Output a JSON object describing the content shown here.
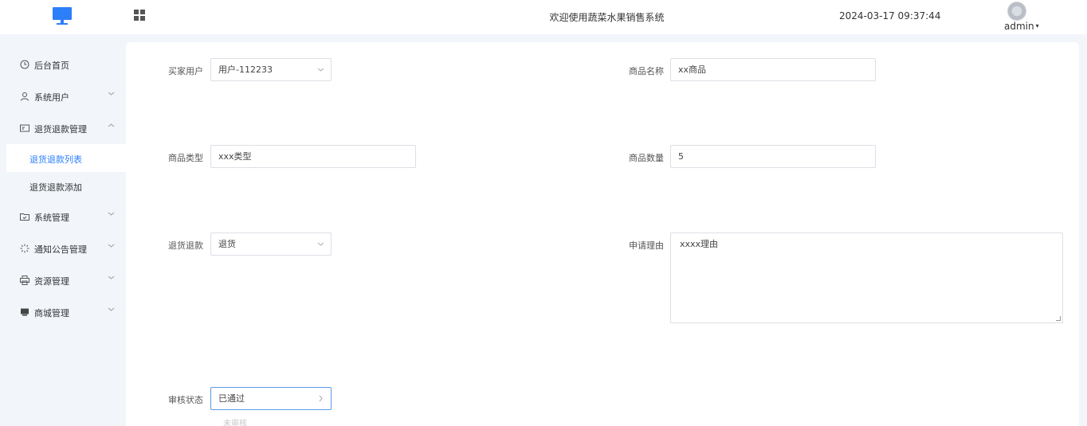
{
  "header": {
    "title": "欢迎使用蔬菜水果销售系统",
    "datetime": "2024-03-17 09:37:44",
    "username": "admin",
    "caret": "▾"
  },
  "sidebar": {
    "items": [
      {
        "label": "后台首页",
        "icon": "clock-icon"
      },
      {
        "label": "系统用户",
        "icon": "user-icon"
      },
      {
        "label": "退货退款管理",
        "icon": "card-icon"
      },
      {
        "label": "系统管理",
        "icon": "folder-icon"
      },
      {
        "label": "通知公告管理",
        "icon": "spinner-icon"
      },
      {
        "label": "资源管理",
        "icon": "printer-icon"
      },
      {
        "label": "商城管理",
        "icon": "monitor-icon"
      }
    ],
    "sub_items": [
      {
        "label": "退货退款列表",
        "active": true
      },
      {
        "label": "退货退款添加",
        "active": false
      }
    ]
  },
  "form": {
    "buyer_label": "买家用户",
    "buyer_value": "用户-112233",
    "product_name_label": "商品名称",
    "product_name_value": "xx商品",
    "product_type_label": "商品类型",
    "product_type_value": "xxx类型",
    "quantity_label": "商品数量",
    "quantity_value": "5",
    "refund_type_label": "退货退款",
    "refund_type_value": "退货",
    "reason_label": "申请理由",
    "reason_value": "xxxx理由",
    "status_label": "审核状态",
    "status_value": "已通过",
    "status_ghost": "未审核"
  },
  "colors": {
    "accent": "#2d7ff9",
    "sidebar_bg": "#f2f6fb",
    "border": "#dcdfe6"
  }
}
